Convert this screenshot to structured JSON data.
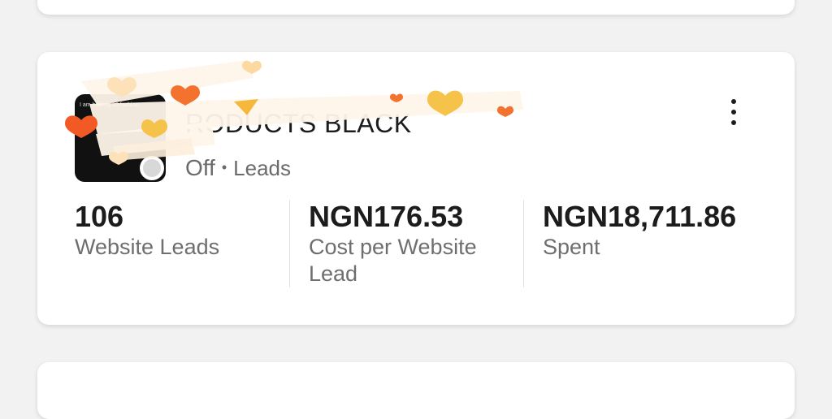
{
  "campaign": {
    "name": "RODUCTS BLACK",
    "thumbnail_text": "I am helping 20 fashion",
    "status": "Off",
    "separator": "•",
    "objective": "Leads"
  },
  "metrics": [
    {
      "value": "106",
      "label": "Website Leads"
    },
    {
      "value": "NGN176.53",
      "label": "Cost per Website Lead"
    },
    {
      "value": "NGN18,711.86",
      "label": "Spent"
    }
  ],
  "icons": {
    "menu": "more-vertical-icon",
    "status": "status-dot-icon"
  },
  "colors": {
    "status_off": "#d8d8d8",
    "scribble_orange": "#f2722e",
    "scribble_yellow": "#f5c24a",
    "scribble_cream": "#fde9c8"
  }
}
